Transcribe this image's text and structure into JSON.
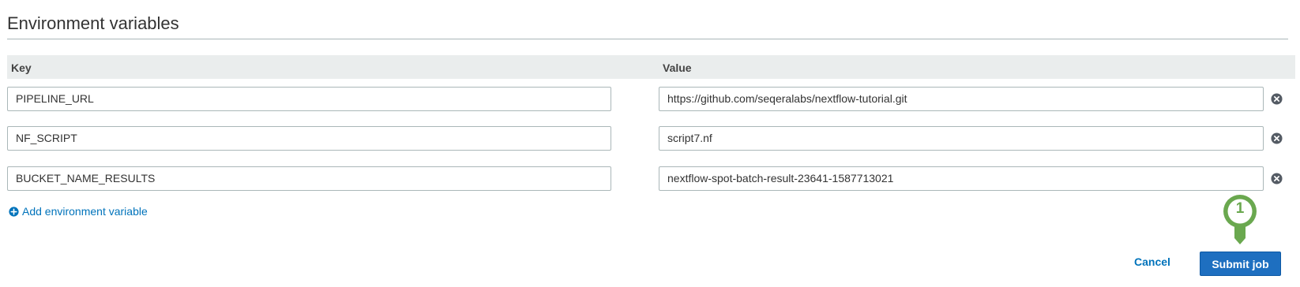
{
  "section": {
    "title": "Environment variables"
  },
  "table": {
    "key_header": "Key",
    "value_header": "Value"
  },
  "rows": [
    {
      "key": "PIPELINE_URL",
      "value": "https://github.com/seqeralabs/nextflow-tutorial.git"
    },
    {
      "key": "NF_SCRIPT",
      "value": "script7.nf"
    },
    {
      "key": "BUCKET_NAME_RESULTS",
      "value": "nextflow-spot-batch-result-23641-1587713021"
    }
  ],
  "actions": {
    "add_label": "Add environment variable",
    "cancel_label": "Cancel",
    "submit_label": "Submit job"
  },
  "annotation": {
    "step": "1",
    "color": "#6aa84f"
  },
  "colors": {
    "link": "#0073bb",
    "primary": "#1e6fc0",
    "header_bg": "#eaeded"
  },
  "icons": {
    "remove": "remove-icon",
    "add": "plus-circle-icon"
  }
}
